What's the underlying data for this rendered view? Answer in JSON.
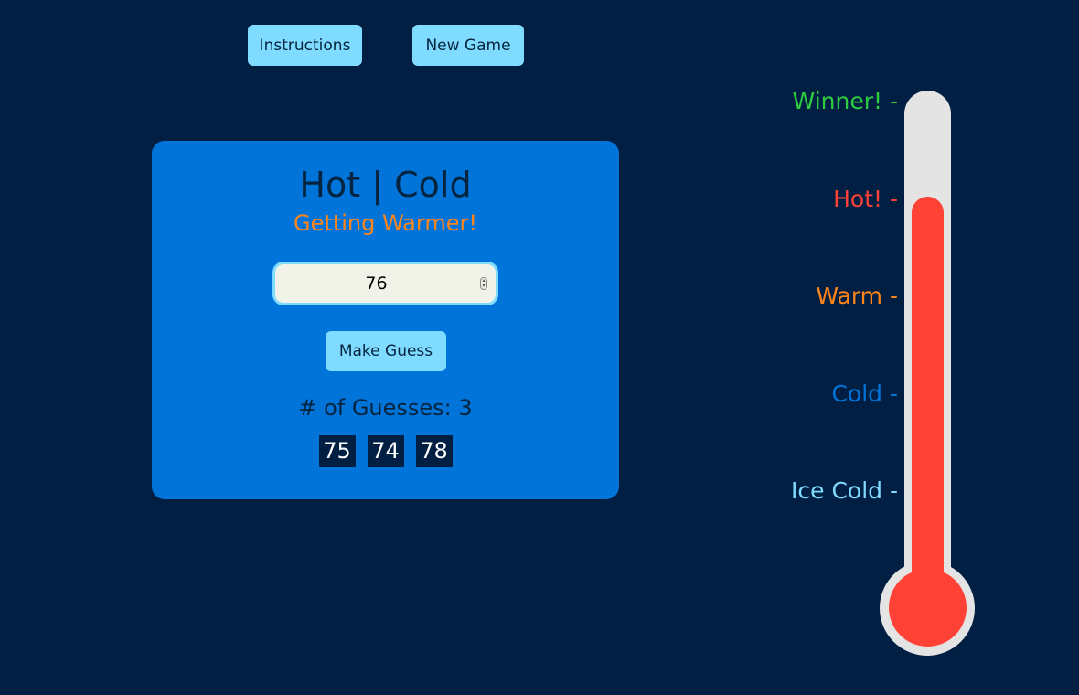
{
  "toolbar": {
    "instructions_label": "Instructions",
    "new_game_label": "New Game"
  },
  "game": {
    "title": "Hot | Cold",
    "feedback": "Getting Warmer!",
    "feedback_color": "#ff851b",
    "guess_input_value": "76",
    "make_guess_label": "Make Guess",
    "guess_count_text": "# of Guesses: 3",
    "previous_guesses": [
      "75",
      "74",
      "78"
    ]
  },
  "thermometer": {
    "scale": [
      {
        "label": "Winner! -",
        "color": "#2ecc40"
      },
      {
        "label": "Hot! -",
        "color": "#ff4136"
      },
      {
        "label": "Warm -",
        "color": "#ff851b"
      },
      {
        "label": "Cold -",
        "color": "#0074d9"
      },
      {
        "label": "Ice Cold -",
        "color": "#7fdbff"
      }
    ],
    "mercury_level": 0.79,
    "mercury_color": "#ff4136",
    "tube_color": "#e4e4e4"
  },
  "colors": {
    "background": "#011f42",
    "card": "#0074d9",
    "button": "#7fdbff"
  }
}
